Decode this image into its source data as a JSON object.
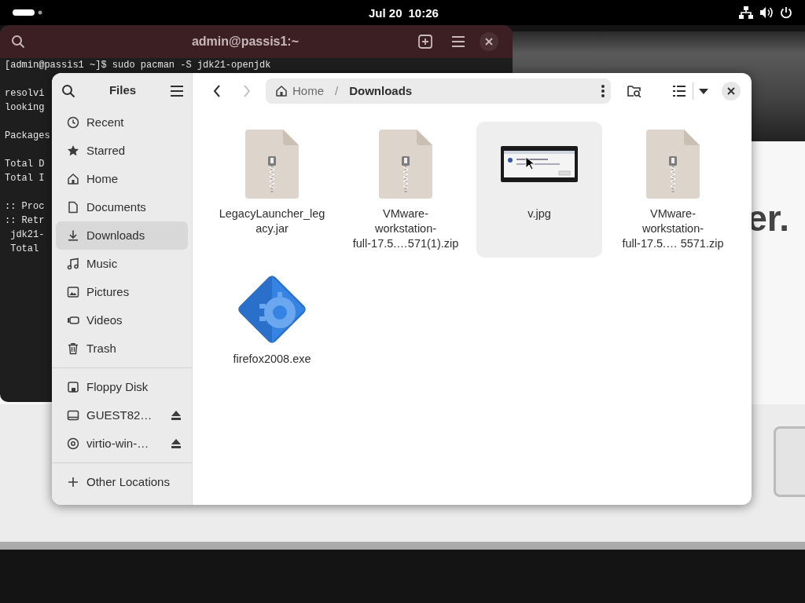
{
  "top_bar": {
    "date": "Jul 20",
    "time": "10:26"
  },
  "background_window": {
    "text": "er."
  },
  "terminal": {
    "title": "admin@passis1:~",
    "blocks": [
      [
        "[admin@passis1 ~]$ sudo pacman -S jdk21-openjdk"
      ],
      [
        "resolvi",
        "looking"
      ],
      [
        "Packages"
      ],
      [
        "Total D",
        "Total I"
      ],
      [
        ":: Proc",
        ":: Retr",
        " jdk21-",
        " Total"
      ]
    ]
  },
  "files": {
    "sidebar": {
      "title": "Files",
      "places": [
        {
          "label": "Recent",
          "selected": false
        },
        {
          "label": "Starred",
          "selected": false
        },
        {
          "label": "Home",
          "selected": false
        },
        {
          "label": "Documents",
          "selected": false
        },
        {
          "label": "Downloads",
          "selected": true
        },
        {
          "label": "Music",
          "selected": false
        },
        {
          "label": "Pictures",
          "selected": false
        },
        {
          "label": "Videos",
          "selected": false
        },
        {
          "label": "Trash",
          "selected": false
        }
      ],
      "devices": [
        {
          "label": "Floppy Disk",
          "eject": false
        },
        {
          "label": "GUEST82…",
          "eject": true
        },
        {
          "label": "virtio-win-…",
          "eject": true
        }
      ],
      "other": "Other Locations"
    },
    "toolbar": {
      "back_disabled": false,
      "forward_disabled": true,
      "path": [
        "Home",
        "Downloads"
      ],
      "path_separator": "/"
    },
    "items": [
      {
        "name": "LegacyLauncher_leg\nacy.jar",
        "kind": "archive",
        "hovered": false
      },
      {
        "name": "VMware-\nworkstation-\nfull-17.5.…571(1).zip",
        "kind": "archive",
        "hovered": false
      },
      {
        "name": "v.jpg",
        "kind": "image",
        "hovered": true
      },
      {
        "name": "VMware-\nworkstation-\nfull-17.5.… 5571.zip",
        "kind": "archive",
        "hovered": false
      },
      {
        "name": "firefox2008.exe",
        "kind": "executable",
        "hovered": false
      }
    ]
  }
}
